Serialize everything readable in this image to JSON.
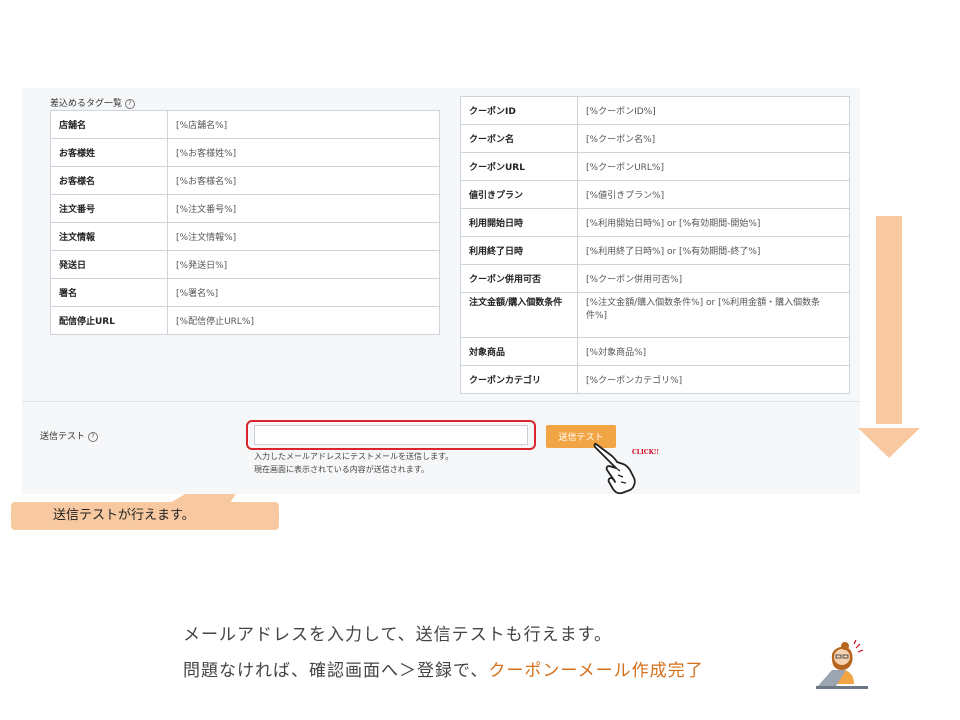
{
  "panel": {
    "tags_title": "差込めるタグ一覧",
    "help_glyph": "?",
    "left_table": [
      {
        "key": "店舗名",
        "value": "[%店舗名%]"
      },
      {
        "key": "お客様姓",
        "value": "[%お客様姓%]"
      },
      {
        "key": "お客様名",
        "value": "[%お客様名%]"
      },
      {
        "key": "注文番号",
        "value": "[%注文番号%]"
      },
      {
        "key": "注文情報",
        "value": "[%注文情報%]"
      },
      {
        "key": "発送日",
        "value": "[%発送日%]"
      },
      {
        "key": "署名",
        "value": "[%署名%]"
      },
      {
        "key": "配信停止URL",
        "value": "[%配信停止URL%]"
      }
    ],
    "right_table": [
      {
        "key": "クーポンID",
        "value": "[%クーポンID%]"
      },
      {
        "key": "クーポン名",
        "value": "[%クーポン名%]"
      },
      {
        "key": "クーポンURL",
        "value": "[%クーポンURL%]"
      },
      {
        "key": "値引きプラン",
        "value": "[%値引きプラン%]"
      },
      {
        "key": "利用開始日時",
        "value": "[%利用開始日時%] or [%有効期間-開始%]"
      },
      {
        "key": "利用終了日時",
        "value": "[%利用終了日時%] or [%有効期間-終了%]"
      },
      {
        "key": "クーポン併用可否",
        "value": "[%クーポン併用可否%]"
      },
      {
        "key": "注文金額/購入個数条件",
        "value": "[%注文金額/購入個数条件%] or [%利用金額・購入個数条件%]"
      },
      {
        "key": "対象商品",
        "value": "[%対象商品%]"
      },
      {
        "key": "クーポンカテゴリ",
        "value": "[%クーポンカテゴリ%]"
      }
    ],
    "send_test_label": "送信テスト",
    "email_value": "",
    "send_button": "送信テスト",
    "help_line1": "入力したメールアドレスにテストメールを送信します。",
    "help_line2": "現在画面に表示されている内容が送信されます。",
    "click_text": "CLICK!!"
  },
  "callout_text": "送信テストが行えます。",
  "caption": {
    "line1": "メールアドレスを入力して、送信テストも行えます。",
    "line2_prefix": "問題なければ、確認画面へ＞登録で、",
    "line2_highlight": "クーポンーメール作成完了"
  },
  "colors": {
    "accent_orange": "#f2a545",
    "highlight_text": "#d5701b",
    "frame_red": "#d8262c",
    "callout_bg": "#f8c9a0",
    "arrow": "#f8c9a0"
  },
  "icons": {
    "help": "question-circle-icon",
    "hand": "pointing-hand-icon",
    "arrow": "down-arrow-icon",
    "worker": "office-worker-icon"
  }
}
